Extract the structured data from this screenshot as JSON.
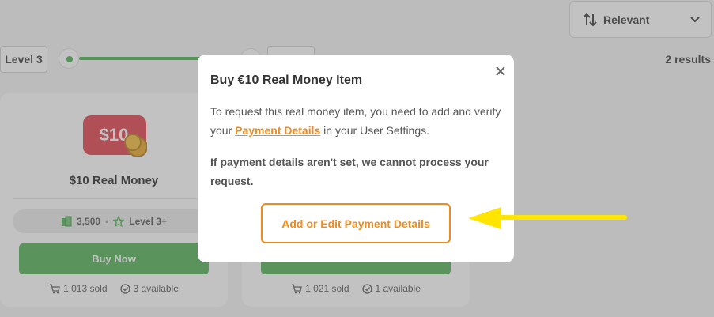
{
  "sort": {
    "label": "Relevant"
  },
  "filters": {
    "level_label": "Level 3"
  },
  "results_label": "2 results",
  "cards": [
    {
      "badge_text": "$10",
      "title": "$10 Real Money",
      "price": "3,500",
      "level": "Level 3+",
      "buy_label": "Buy Now",
      "sold": "1,013 sold",
      "available": "3 available"
    },
    {
      "sold": "1,021 sold",
      "available": "1 available"
    }
  ],
  "modal": {
    "title": "Buy €10 Real Money Item",
    "p1_before": "To request this real money item, you need to add and verify your ",
    "p1_link": "Payment Details",
    "p1_after": " in your User Settings.",
    "p2": "If payment details aren't set, we cannot process your request.",
    "button_label": "Add or Edit Payment Details"
  },
  "colors": {
    "accent_orange": "#ef8c1d",
    "green": "#4caf50",
    "arrow_yellow": "#ffe500"
  }
}
